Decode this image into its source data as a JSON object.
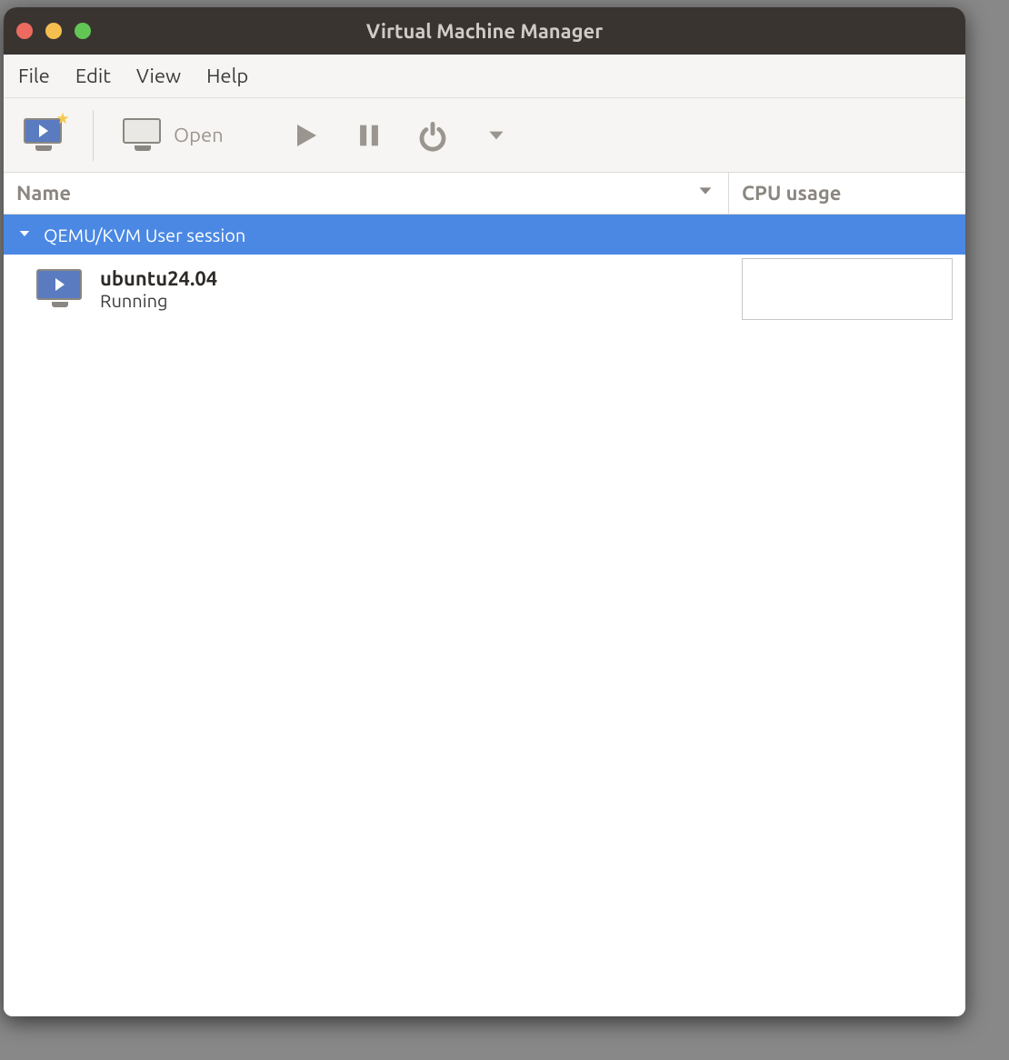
{
  "window": {
    "title": "Virtual Machine Manager"
  },
  "menubar": {
    "items": [
      {
        "label": "File"
      },
      {
        "label": "Edit"
      },
      {
        "label": "View"
      },
      {
        "label": "Help"
      }
    ]
  },
  "toolbar": {
    "open_label": "Open"
  },
  "columns": {
    "name": "Name",
    "cpu": "CPU usage"
  },
  "connection": {
    "label": "QEMU/KVM User session"
  },
  "vm": {
    "name": "ubuntu24.04",
    "state": "Running"
  },
  "colors": {
    "selection": "#4b88e3",
    "titlebar": "#3a3431"
  }
}
